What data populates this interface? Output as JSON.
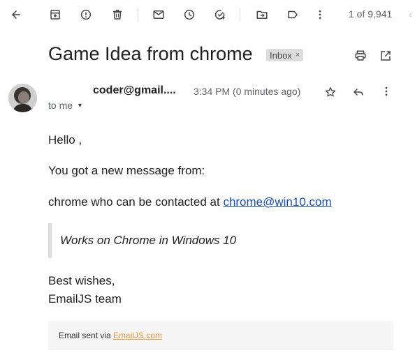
{
  "toolbar": {
    "icons": [
      "back-arrow-icon",
      "archive-icon",
      "report-spam-icon",
      "delete-icon",
      "mark-unread-icon",
      "snooze-icon",
      "add-task-icon",
      "move-to-icon",
      "label-icon",
      "more-vert-icon"
    ],
    "counter": "1 of 9,941",
    "prev_glyph": "‹"
  },
  "email": {
    "subject": "Game Idea from chrome",
    "label_badge": "Inbox",
    "badge_close": "×",
    "sender": "coder@gmail....",
    "time": "3:34 PM (0 minutes ago)",
    "to": "to me",
    "body": {
      "greeting": "Hello ,",
      "line1": "You got a new message from:",
      "line2_prefix": "chrome who can be contacted at ",
      "line2_link": "chrome@win10.com",
      "quote": "Works on Chrome in Windows 10",
      "signoff1": "Best wishes,",
      "signoff2": "EmailJS team"
    },
    "footer": {
      "prefix": "Email sent via ",
      "link": "EmailJS.com"
    }
  },
  "colors": {
    "link": "#1a4fb0",
    "footer_link": "#e8973b",
    "badge_bg": "#dddddd"
  }
}
